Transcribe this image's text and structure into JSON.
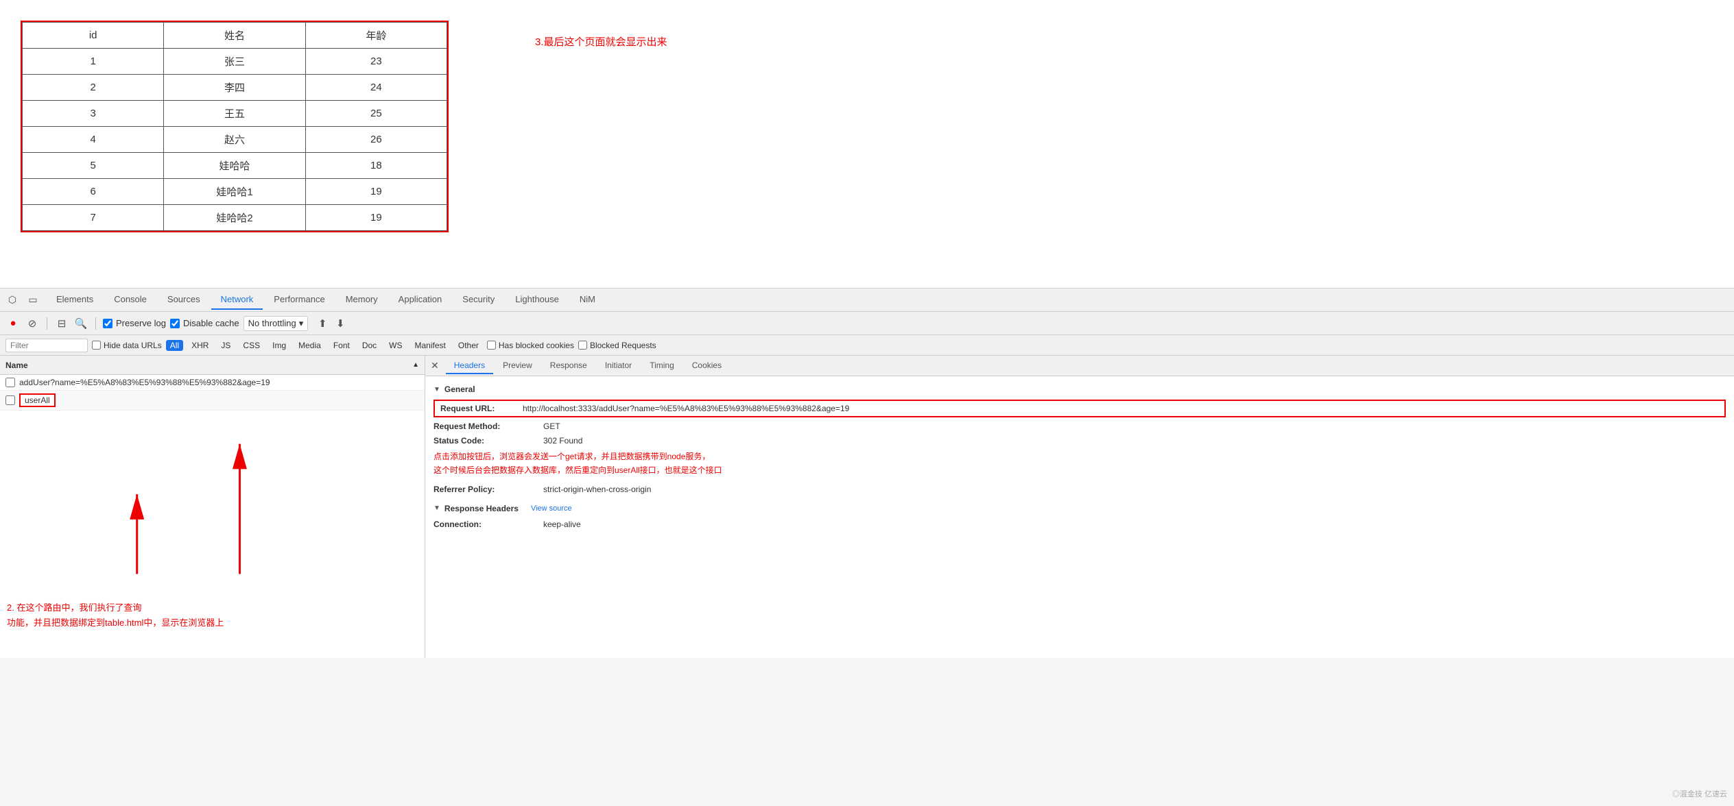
{
  "page": {
    "annotation3": "3.最后这个页面就会显示出来"
  },
  "table": {
    "headers": [
      "id",
      "姓名",
      "年龄"
    ],
    "rows": [
      [
        "1",
        "张三",
        "23"
      ],
      [
        "2",
        "李四",
        "24"
      ],
      [
        "3",
        "王五",
        "25"
      ],
      [
        "4",
        "赵六",
        "26"
      ],
      [
        "5",
        "娃哈哈",
        "18"
      ],
      [
        "6",
        "娃哈哈1",
        "19"
      ],
      [
        "7",
        "娃哈哈2",
        "19"
      ]
    ]
  },
  "devtools": {
    "tabs": [
      "Elements",
      "Console",
      "Sources",
      "Network",
      "Performance",
      "Memory",
      "Application",
      "Security",
      "Lighthouse",
      "NiM"
    ],
    "active_tab": "Network",
    "toolbar": {
      "preserve_log": "Preserve log",
      "disable_cache": "Disable cache",
      "no_throttling": "No throttling",
      "upload_icon": "⬆",
      "download_icon": "⬇"
    },
    "filter": {
      "placeholder": "Filter",
      "hide_data_urls": "Hide data URLs",
      "all": "All",
      "xhr": "XHR",
      "js": "JS",
      "css": "CSS",
      "img": "Img",
      "media": "Media",
      "font": "Font",
      "doc": "Doc",
      "ws": "WS",
      "manifest": "Manifest",
      "other": "Other",
      "has_blocked_cookies": "Has blocked cookies",
      "blocked_requests": "Blocked Requests"
    },
    "requests_header": "Name",
    "requests": [
      {
        "name": "addUser?name=%E5%A8%83%E5%93%88%E5%93%882&age=19",
        "checked": false
      },
      {
        "name": "userAll",
        "checked": false,
        "highlighted": true
      }
    ],
    "details": {
      "tabs": [
        "Headers",
        "Preview",
        "Response",
        "Initiator",
        "Timing",
        "Cookies"
      ],
      "active_tab": "Headers",
      "general_section": "General",
      "request_url_label": "Request URL:",
      "request_url_value": "http://localhost:3333/addUser?name=%E5%A8%83%E5%93%88%E5%93%882&age=19",
      "request_method_label": "Request Method:",
      "request_method_value": "GET",
      "status_code_label": "Status Code:",
      "status_code_value": "302 Found",
      "referrer_policy_label": "Referrer Policy:",
      "referrer_policy_value": "strict-origin-when-cross-origin",
      "response_headers_label": "Response Headers",
      "view_source": "View source",
      "connection_label": "Connection:",
      "connection_value": "keep-alive"
    },
    "annotation2_line1": "2. 在这个路由中，我们执行了查询",
    "annotation2_line2": "功能，并且把数据绑定到table.html中，显示在浏览器上",
    "annotation_red1": "点击添加按钮后，浏览器会发送一个get请求，并且把数据携带到node服务，",
    "annotation_red2": "这个时候后台会把数据存入数据库，然后重定向到userAll接口，也就是这个接口"
  },
  "watermark": "◎混金技 亿速云"
}
